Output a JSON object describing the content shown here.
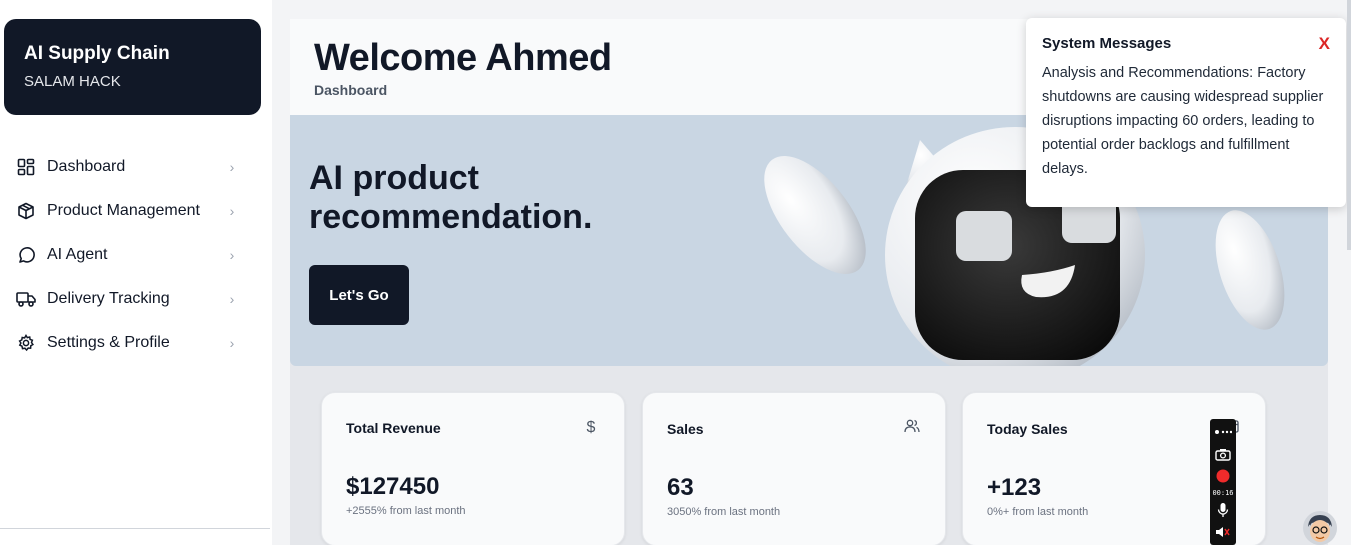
{
  "sidebar": {
    "brand_title": "AI Supply Chain",
    "brand_subtitle": "SALAM HACK",
    "items": [
      {
        "label": "Dashboard",
        "icon": "dashboard-grid-icon"
      },
      {
        "label": "Product Management",
        "icon": "package-icon"
      },
      {
        "label": "AI Agent",
        "icon": "chat-bubble-icon"
      },
      {
        "label": "Delivery Tracking",
        "icon": "truck-icon"
      },
      {
        "label": "Settings & Profile",
        "icon": "gear-icon"
      }
    ]
  },
  "header": {
    "welcome": "Welcome Ahmed",
    "breadcrumb": "Dashboard"
  },
  "hero": {
    "title": "AI product recommendation.",
    "button": "Let's Go"
  },
  "cards": [
    {
      "title": "Total Revenue",
      "icon": "dollar-icon",
      "value": "$127450",
      "sub": "+2555% from last month"
    },
    {
      "title": "Sales",
      "icon": "users-icon",
      "value": "63",
      "sub": "3050% from last month"
    },
    {
      "title": "Today Sales",
      "icon": "calendar-icon",
      "value": "+123",
      "sub": "0%+ from last month"
    }
  ],
  "system_messages": {
    "title": "System Messages",
    "close": "X",
    "body": "Analysis and Recommendations: Factory shutdowns are causing widespread supplier disruptions impacting 60 orders, leading to potential order backlogs and fulfillment delays."
  },
  "recorder": {
    "time": "00:16"
  },
  "colors": {
    "brand_dark": "#111827",
    "hero_bg": "#c9d6e3",
    "close_red": "#dc2626",
    "record_red": "#ef2b2b"
  }
}
